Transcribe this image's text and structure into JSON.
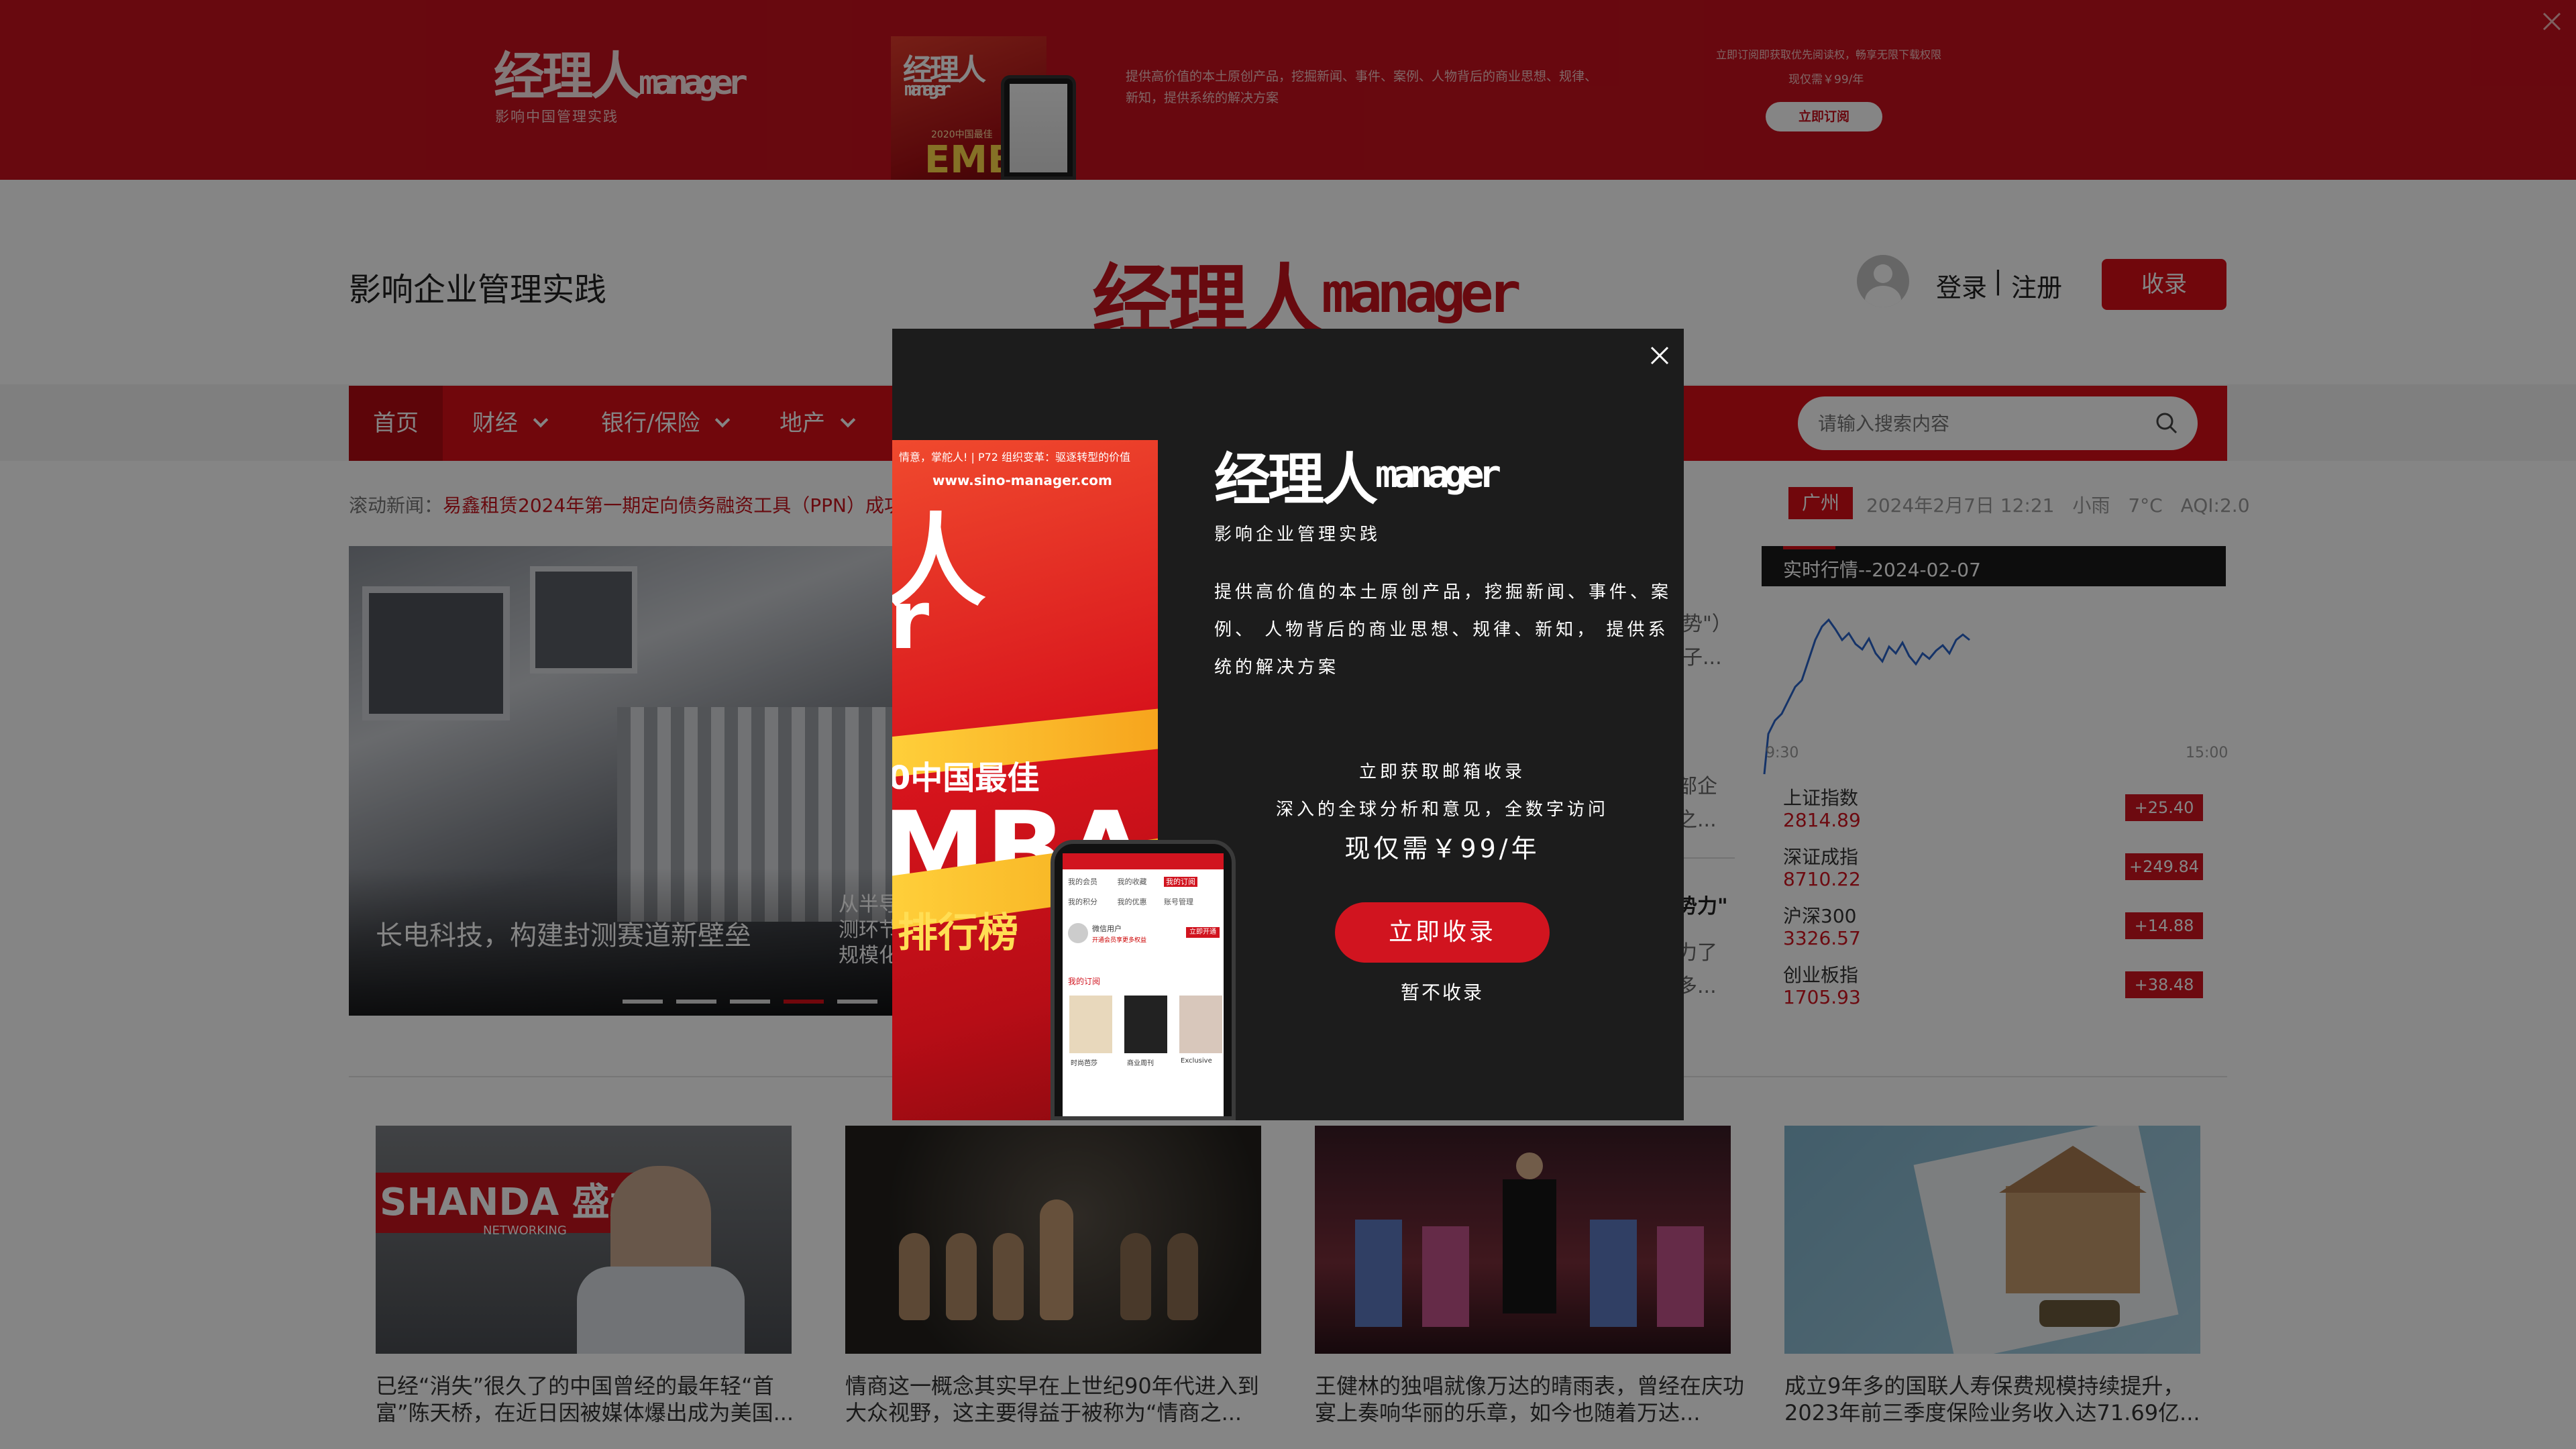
{
  "ad_banner": {
    "logo_cn": "经理人",
    "logo_en": "manager",
    "slogan": "影响中国管理实践",
    "cover_title": "经理人",
    "cover_en": "manager",
    "cover_headline": "2020中国最佳",
    "cover_big": "EMB",
    "desc_line1": "提供高价值的本土原创产品，挖掘新闻、事件、案例、人物背后的商业思想、规律、",
    "desc_line2": "新知，提供系统的解决方案",
    "promo_line1": "立即订阅即获取优先阅读权，畅享无限下载权限",
    "promo_line2": "现仅需￥99/年",
    "subscribe_label": "立即订阅"
  },
  "header": {
    "slogan": "影响企业管理实践",
    "logo_cn": "经理人",
    "logo_en": "manager",
    "login_label": "登录",
    "separator": "|",
    "register_label": "注册",
    "collect_label": "收录"
  },
  "nav": {
    "items": [
      {
        "label": "首页"
      },
      {
        "label": "财经"
      },
      {
        "label": "银行/保险"
      },
      {
        "label": "地产"
      }
    ],
    "search_placeholder": "请输入搜索内容"
  },
  "ticker": {
    "prefix": "滚动新闻：",
    "headline": "易鑫租赁2024年第一期定向债务融资工具（PPN）成功"
  },
  "weather": {
    "city": "广州",
    "datetime": "2024年2月7日 12:21",
    "condition": "小雨",
    "temp": "7°C",
    "aqi": "AQI:2.0"
  },
  "hero": {
    "caption": "长电科技，构建封测赛道新壁垒",
    "peek_line1": "从半导",
    "peek_line2": "测环节",
    "peek_line3": "规模化",
    "active_dot": 4
  },
  "side_news": [
    {
      "line1": "势\"）",
      "line2": "子..."
    },
    {
      "line1": "部企",
      "line2": "之..."
    },
    {
      "line1": "势力\"",
      "line2": ""
    },
    {
      "line1": "力了",
      "line2": "多..."
    }
  ],
  "market": {
    "title": "实时行情--2024-02-07",
    "axis_start": "9:30",
    "axis_end": "15:00",
    "quotes": [
      {
        "name": "上证指数",
        "value": "2814.89",
        "change": "+25.40"
      },
      {
        "name": "深证成指",
        "value": "8710.22",
        "change": "+249.84"
      },
      {
        "name": "沪深300",
        "value": "3326.57",
        "change": "+14.88"
      },
      {
        "name": "创业板指",
        "value": "1705.93",
        "change": "+38.48"
      }
    ]
  },
  "articles": [
    {
      "title": "已经“消失”很久了的中国曾经的最年轻“首富”陈天桥，在近日因被媒体爆出成为美国...",
      "img_text": "SHANDA 盛大",
      "img_sub": "NETWORKING"
    },
    {
      "title": "情商这一概念其实早在上世纪90年代进入到大众视野，这主要得益于被称为“情商之..."
    },
    {
      "title": "王健林的独唱就像万达的晴雨表，曾经在庆功宴上奏响华丽的乐章，如今也随着万达..."
    },
    {
      "title": "成立9年多的国联人寿保费规模持续提升，2023年前三季度保险业务收入达71.69亿..."
    }
  ],
  "modal": {
    "logo_cn": "经理人",
    "logo_en": "manager",
    "tagline": "影响企业管理实践",
    "desc_line1": "提供高价值的本土原创产品，挖掘新闻、事件、案",
    "desc_line2": "例、 人物背后的商业思想、规律、新知， 提供系",
    "desc_line3": "统的解决方案",
    "offer_line1": "立即获取邮箱收录",
    "offer_line2": "深入的全球分析和意见，全数字访问",
    "price": "现仅需￥99/年",
    "cta_label": "立即收录",
    "dismiss_label": "暂不收录",
    "cover": {
      "top_text": "情意，掌舵人! | P72 组织变革：驱逐转型的价值",
      "url": "www.sino-manager.com",
      "big1": "人",
      "big2": "r",
      "headline": "0中国最佳",
      "mba": "MBA",
      "rank": "排行榜"
    },
    "phone": {
      "rows": [
        [
          "我的会员",
          "我的收藏",
          "我的订阅"
        ],
        [
          "我的积分",
          "我的优惠",
          "账号管理"
        ]
      ],
      "user": "微信用户",
      "user_sub": "开通会员享更多权益",
      "open_label": "立即开通",
      "section": "我的订阅",
      "mags": [
        "时尚芭莎",
        "商业周刊",
        "Exclusive"
      ]
    }
  },
  "colors": {
    "brand_red": "#d80e17",
    "banner_red": "#c7111d",
    "quote_up": "#d1141f",
    "modal_bg": "#1c1c1c"
  }
}
